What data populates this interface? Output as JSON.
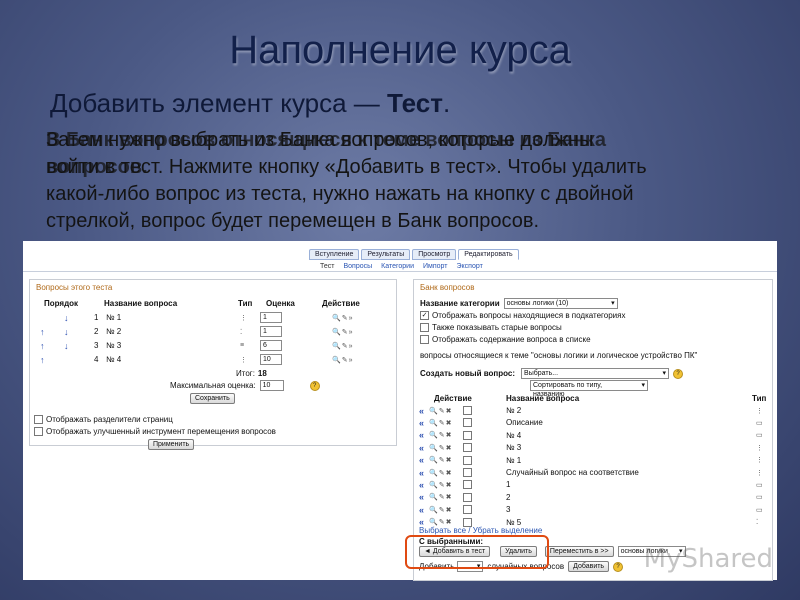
{
  "slide": {
    "title": "Наполнение курса",
    "subtitle_prefix": "Добавить элемент курса — ",
    "subtitle_bold": "Тест",
    "subtitle_suffix": ".",
    "body_lines": [
      "Затем нужно выбрать из Банка вопросов, которые должны",
      "войти в тест. Нажмите кнопку «Добавить в тест». Чтобы удалить",
      "какой-либо вопрос из теста, нужно нажать на кнопку с двойной",
      "стрелкой, вопрос будет перемещен в Банк вопросов."
    ],
    "ghost_lines": [
      "В Банк вопросов относящиеся к теме вопросы из Банка",
      "вопросов."
    ]
  },
  "moodle": {
    "tabs": [
      "Вступление",
      "Результаты",
      "Просмотр",
      "Редактировать"
    ],
    "subtabs": [
      "Тест",
      "Вопросы",
      "Категории",
      "Импорт",
      "Экспорт"
    ],
    "left": {
      "heading": "Вопросы этого теста",
      "headers": {
        "order": "Порядок",
        "name": "Название вопроса",
        "type": "Тип",
        "grade": "Оценка",
        "action": "Действие"
      },
      "rows": [
        {
          "num": "1",
          "name": "№ 1",
          "grade": "1"
        },
        {
          "num": "2",
          "name": "№ 2",
          "grade": "1"
        },
        {
          "num": "3",
          "name": "№ 3",
          "grade": "6"
        },
        {
          "num": "4",
          "name": "№ 4",
          "grade": "10"
        }
      ],
      "total_label": "Итог:",
      "total_value": "18",
      "max_label": "Максимальная оценка:",
      "max_value": "10",
      "save": "Сохранить",
      "opt1": "Отображать разделители страниц",
      "opt2": "Отображать улучшенный инструмент перемещения вопросов",
      "apply": "Применить"
    },
    "right": {
      "heading": "Банк вопросов",
      "category_label": "Название категории",
      "category_value": "основы логики (10)",
      "chk1": "Отображать вопросы находящиеся в подкатегориях",
      "chk2": "Также показывать старые вопросы",
      "chk3": "Отображать содержание вопроса в списке",
      "note": "вопросы относящиеся к теме \"основы логики и логическое устройство ПК\"",
      "create_label": "Создать новый вопрос:",
      "create_value": "Выбрать...",
      "sort_value": "Сортировать по типу, названию",
      "headers": {
        "action": "Действие",
        "name": "Название вопроса",
        "type": "Тип"
      },
      "rows": [
        "№ 2",
        "Описание",
        "№ 4",
        "№ 3",
        "№ 1",
        "Случайный вопрос на соответствие",
        "1",
        "2",
        "3",
        "№ 5"
      ],
      "row_types": [
        "⋮",
        "▭",
        "▭",
        "⋮",
        "⋮",
        "⋮",
        "▭",
        "▭",
        "▭",
        "⁚"
      ],
      "select_links": "Выбрать все / Убрать выделение",
      "with_selected": "С выбранными:",
      "add_button": "◄ Добавить в тест",
      "delete_button": "Удалить",
      "move_button": "Переместить в >>",
      "move_select": "основы логики",
      "add_random_label": "Добавить",
      "add_random_suffix": "случайных вопросов",
      "add_random_button": "Добавить"
    },
    "watermark": "MyShared"
  }
}
